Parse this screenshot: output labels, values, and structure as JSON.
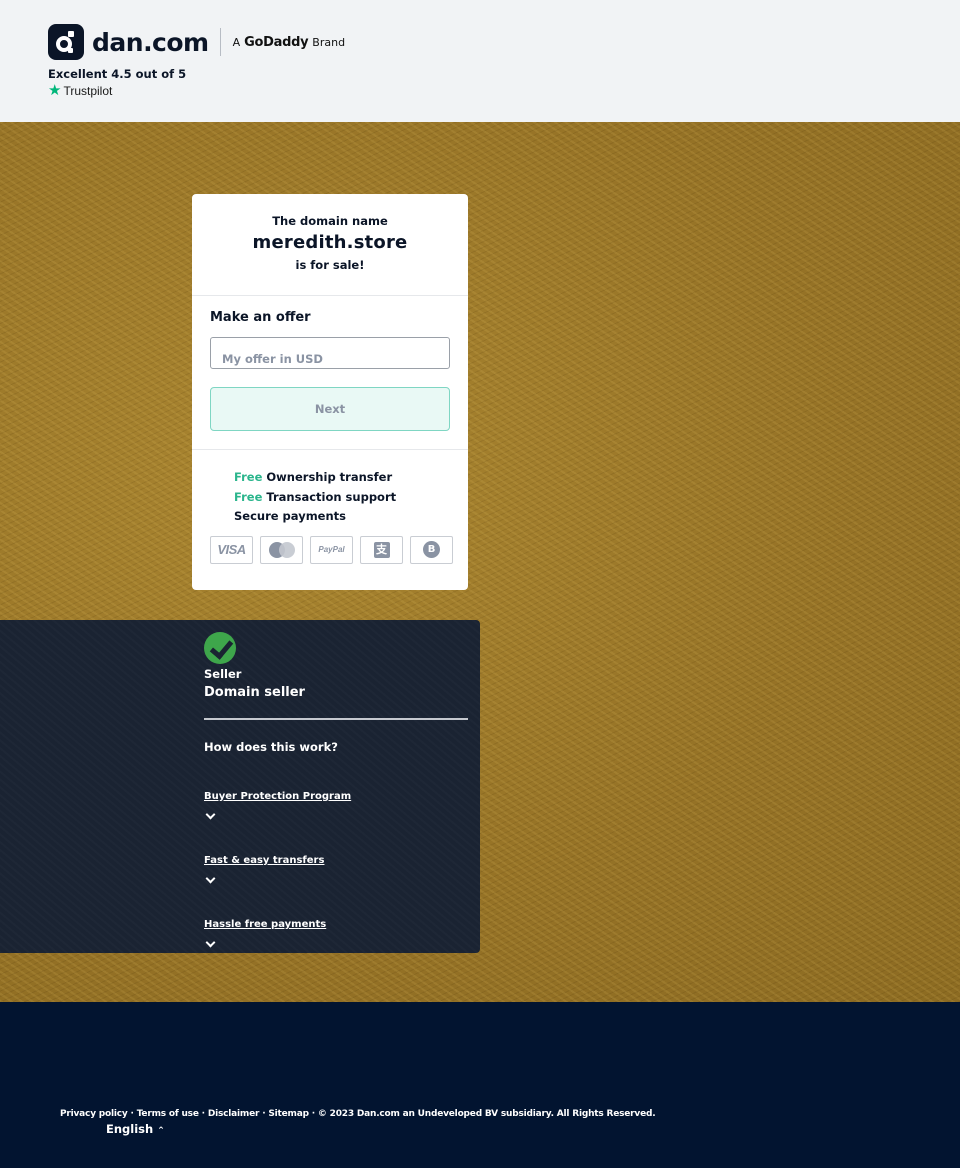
{
  "header": {
    "logo_text": "dan.com",
    "brand_prefix": "A",
    "brand_name": "GoDaddy",
    "brand_suffix": "Brand",
    "rating_text": "Excellent 4.5 out of 5",
    "trustpilot_label": "Trustpilot"
  },
  "card": {
    "line1": "The domain name",
    "domain": "meredith.store",
    "line3": "is for sale!",
    "offer_heading": "Make an offer",
    "offer_placeholder": "My offer in USD",
    "offer_value": "",
    "next_label": "Next",
    "features": [
      {
        "prefix": "Free",
        "text": "Ownership transfer"
      },
      {
        "prefix": "Free",
        "text": "Transaction support"
      },
      {
        "prefix": "",
        "text": "Secure payments"
      }
    ],
    "payment_methods": [
      "VISA",
      "Mastercard",
      "PayPal",
      "Alipay",
      "Bitcoin"
    ],
    "paypal_text": "PayPal",
    "visa_text": "VISA",
    "alipay_glyph": "支",
    "bitcoin_glyph": "B"
  },
  "seller": {
    "label": "Seller",
    "name": "Domain seller",
    "how_heading": "How does this work?",
    "accordion": [
      {
        "title": "Buyer Protection Program"
      },
      {
        "title": "Fast & easy transfers"
      },
      {
        "title": "Hassle free payments"
      }
    ]
  },
  "footer": {
    "links": [
      "Privacy policy",
      "Terms of use",
      "Disclaimer",
      "Sitemap"
    ],
    "separator": " · ",
    "copyright": "© 2023 Dan.com an Undeveloped BV subsidiary. All Rights Reserved.",
    "language": "English",
    "language_caret": "⌃"
  },
  "colors": {
    "accent_green": "#2bb58c",
    "navy": "#0b1527",
    "footer_bg": "#021430",
    "seller_bg": "#1a2332",
    "check_green": "#3ea64b"
  }
}
